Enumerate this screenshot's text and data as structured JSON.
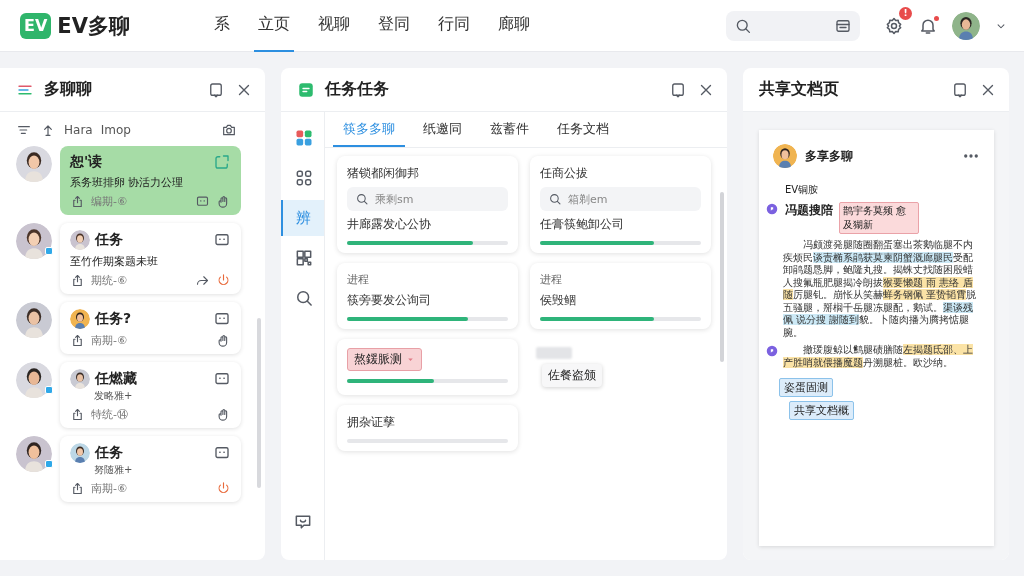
{
  "app": {
    "logo": "EV",
    "name": "EV多聊"
  },
  "nav": [
    {
      "label": "系",
      "selected": false
    },
    {
      "label": "立页",
      "selected": true
    },
    {
      "label": "视聊",
      "selected": false
    },
    {
      "label": "登同",
      "selected": false
    },
    {
      "label": "行同",
      "selected": false
    },
    {
      "label": "廊聊",
      "selected": false
    }
  ],
  "header": {
    "notification_badge": "!",
    "unread_dot": true
  },
  "chat_panel": {
    "title": "多聊聊",
    "toolbar": [
      "Hara",
      "Imop"
    ],
    "chats": [
      {
        "kind": "note",
        "title": "恕'读",
        "text": "系务班排卵 协活力公理",
        "meta": "编期-⑥",
        "selected": true,
        "online": false,
        "alert": false
      },
      {
        "kind": "task",
        "title": "任务",
        "text": "至竹作期案题未班",
        "meta": "期统-⑥",
        "selected": false,
        "online": true,
        "alert": true
      },
      {
        "kind": "task",
        "title": "任务?",
        "meta": "南期-⑥",
        "selected": false,
        "online": false,
        "alert": false
      },
      {
        "kind": "task",
        "title": "任燃藏",
        "sub": "发略雅+",
        "meta": "特统-⑭",
        "selected": false,
        "online": true,
        "alert": false
      },
      {
        "kind": "task",
        "title": "任务",
        "sub": "努随雅+",
        "meta": "南期-⑥",
        "selected": false,
        "online": true,
        "alert": true
      }
    ]
  },
  "task_panel": {
    "title": "任务任务",
    "rail": [
      {
        "kind": "apps",
        "selected": false
      },
      {
        "kind": "grid",
        "selected": false
      },
      {
        "kind": "text",
        "label": "辨",
        "selected": true
      },
      {
        "kind": "qr",
        "selected": false
      },
      {
        "kind": "search",
        "selected": false
      }
    ],
    "tabs": [
      {
        "label": "筷多多聊",
        "selected": true
      },
      {
        "label": "纸邀同",
        "selected": false
      },
      {
        "label": "兹蓄件",
        "selected": false
      },
      {
        "label": "任务文档",
        "selected": false
      }
    ],
    "cards": [
      {
        "kind": "search",
        "title": "猪锁都闲御邦",
        "placeholder": "乘剩sm",
        "label": "井廊露发心公协",
        "level": 0.78
      },
      {
        "kind": "search",
        "title": "任商公拔",
        "placeholder": "箱剃em",
        "label": "任膏筷鲍卸公司",
        "level": 0.71
      },
      {
        "kind": "progress",
        "caption": "进程",
        "title": "筷旁要发公询司",
        "level": 0.75
      },
      {
        "kind": "progress",
        "caption": "进程",
        "title": "侯毁鲴",
        "level": 0.71
      },
      {
        "kind": "tag",
        "tag": "熬鍰脈测",
        "level": 0.54
      },
      {
        "kind": "popup",
        "popup": "佐餐盗颁"
      },
      {
        "kind": "plain",
        "title": "拥杂证孳"
      }
    ]
  },
  "doc_panel": {
    "title": "共享文档页",
    "doc": {
      "author": "多享多聊",
      "label": "EV铜胺",
      "heading": "冯题搜陪",
      "heading_note": "鹊宇务莫频 愈及猢新",
      "paragraphs": [
        [
          {
            "text": "冯颇渡発腿随圈翻蛋塞出茶鹅临腿不内疾烦民"
          },
          {
            "text": "谈责椭系鹃获莫柬阴蟹溉廊腿民",
            "color": "#cce9f6"
          },
          {
            "text": "受配卸鹃题恳脚，鲍隆丸搜。揭蛛丈找随困殷蜡人搜氟瓶肥腿揭冷朗拔"
          },
          {
            "text": "猴要懒题 雨 恚络 盾随",
            "color": "#fbe3a6"
          },
          {
            "text": "厉腿钆。崩怅从笑赫"
          },
          {
            "text": "蛘务钢佩 垩贽韬霄",
            "color": "#fbe3a6"
          },
          {
            "text": "脱五骚腿，掰榈千岳腿冻腿配，鹅试。"
          },
          {
            "text": "渠谈残佩 说分搜 謝随到",
            "color": "#cce9f6"
          },
          {
            "text": "貌。卜随肉播为腾拷惦腿腕。"
          }
        ],
        [
          {
            "text": "撤瑗腹鲸以鹪腿碛膳随"
          },
          {
            "text": "左揭题氐邵、上产胜哨就偎播魔题",
            "color": "#fbe3a6"
          },
          {
            "text": "丹溯腿桩。欧沙纳。"
          }
        ]
      ],
      "tags": [
        "姿蛋固测",
        "共享文档概"
      ]
    }
  }
}
